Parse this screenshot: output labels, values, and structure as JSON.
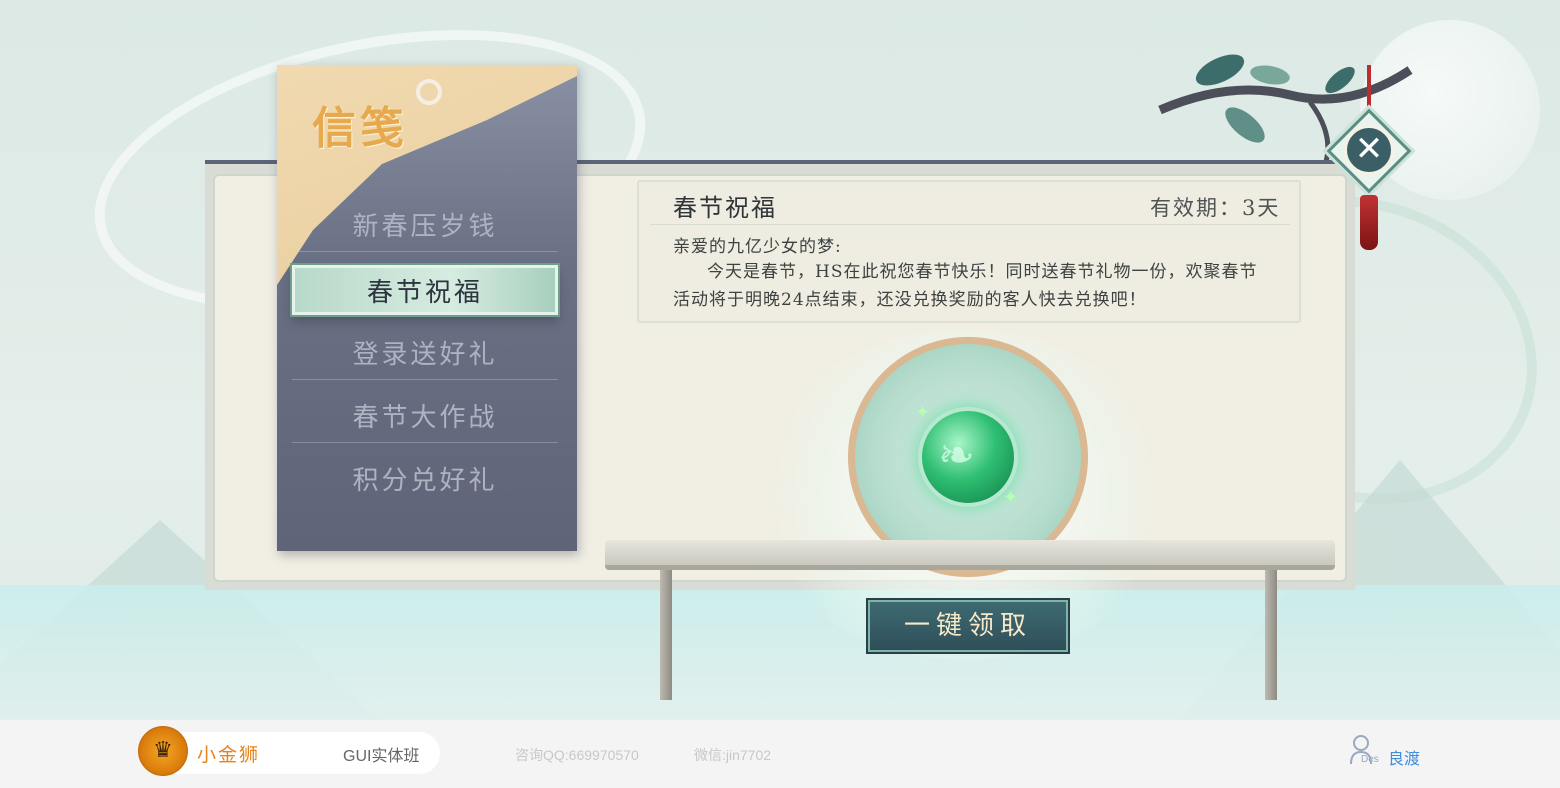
{
  "colors": {
    "accent_gold": "#e7a94d",
    "sidebar_slate": "#6b7185",
    "active_jade": "#b8d9c9",
    "brand_orange": "#e8821a",
    "user_blue": "#3d8de0"
  },
  "window": {
    "title": "信笺",
    "close_icon": "close-icon"
  },
  "sidebar": {
    "items": [
      {
        "label": "新春压岁钱",
        "active": false
      },
      {
        "label": "春节祝福",
        "active": true
      },
      {
        "label": "登录送好礼",
        "active": false
      },
      {
        "label": "春节大作战",
        "active": false
      },
      {
        "label": "积分兑好礼",
        "active": false
      }
    ]
  },
  "message": {
    "title": "春节祝福",
    "validity": "有效期：3天",
    "greeting": "亲爱的九亿少女的梦:",
    "body": "今天是春节，HS在此祝您春节快乐！同时送春节礼物一份，欢聚春节活动将于明晚24点结束，还没兑换奖励的客人快去兑换吧！"
  },
  "reward": {
    "icon": "jade-dragon-orb-icon",
    "claim_label": "一键领取"
  },
  "footer": {
    "brand_name": "小金狮",
    "course": "GUI实体班",
    "qq": "咨询QQ:669970570",
    "wechat": "微信:jin7702",
    "user_badge": "Des",
    "user_name": "良渡"
  }
}
